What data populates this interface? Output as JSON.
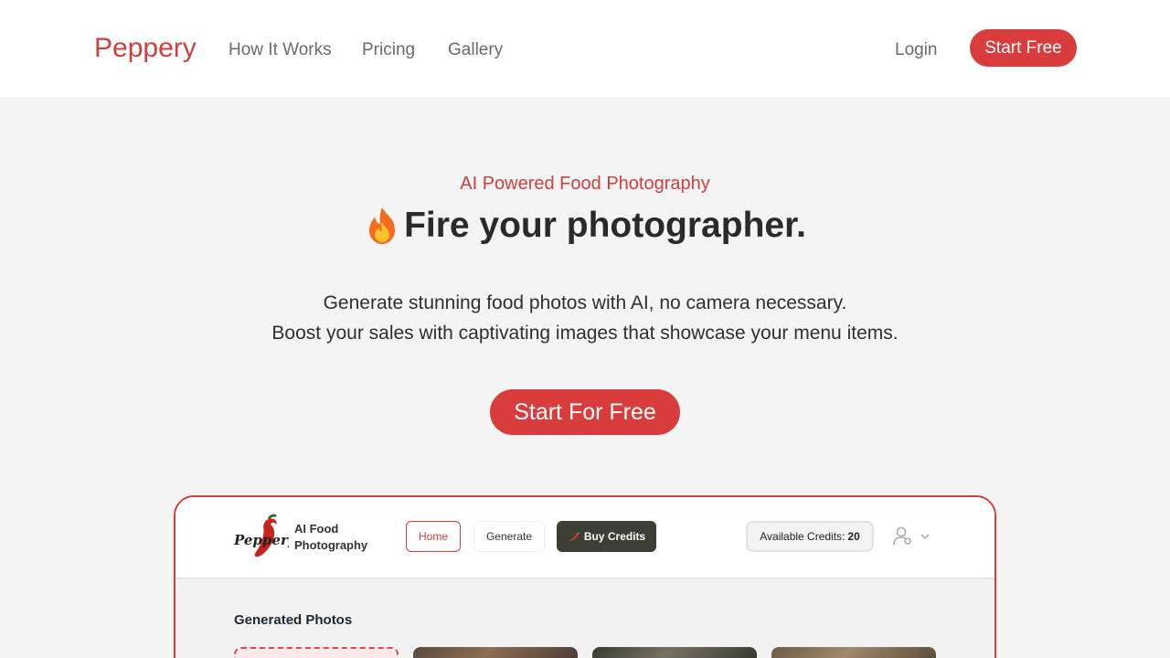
{
  "nav": {
    "brand": "Peppery",
    "links": [
      "How It Works",
      "Pricing",
      "Gallery"
    ],
    "login": "Login",
    "start": "Start Free"
  },
  "hero": {
    "kicker": "AI Powered Food Photography",
    "title": "Fire your photographer.",
    "title_icon": "flame-icon",
    "subtitle_line1": "Generate stunning food photos with AI, no camera necessary.",
    "subtitle_line2": "Boost your sales with captivating images that showcase your menu items.",
    "cta": "Start For Free"
  },
  "preview": {
    "logo_text": "Peppery",
    "brand_line1": "AI Food",
    "brand_line2": "Photography",
    "home": "Home",
    "generate": "Generate",
    "buy_credits": "Buy Credits",
    "credits_label": "Available Credits:",
    "credits_value": "20",
    "section_title": "Generated Photos",
    "user_icon": "user-settings-icon"
  },
  "colors": {
    "accent": "#d93c3c",
    "brand_text": "#cf3f3f",
    "buy_button": "#3c3f33",
    "page_bg": "#f4f4f4"
  }
}
